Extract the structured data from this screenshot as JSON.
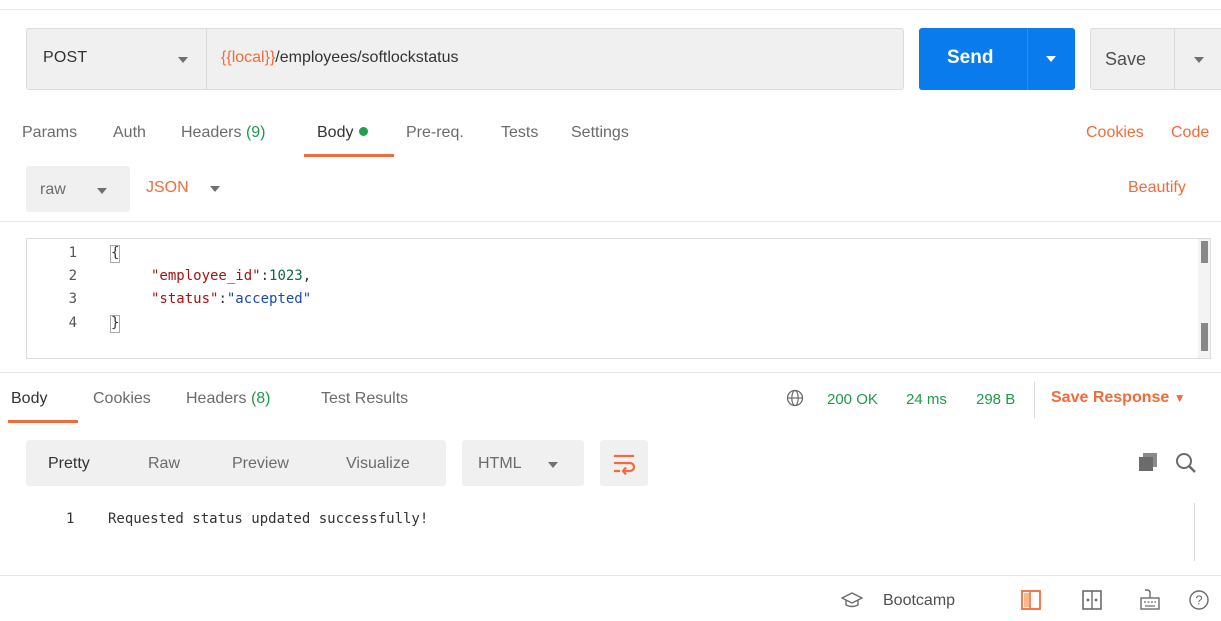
{
  "request": {
    "method": "POST",
    "url_variable": "{{local}}",
    "url_path": "/employees/softlockstatus",
    "send_label": "Send",
    "save_label": "Save"
  },
  "request_tabs": [
    {
      "label": "Params"
    },
    {
      "label": "Auth"
    },
    {
      "label": "Headers",
      "count": "(9)"
    },
    {
      "label": "Body",
      "active": true
    },
    {
      "label": "Pre-req."
    },
    {
      "label": "Tests"
    },
    {
      "label": "Settings"
    }
  ],
  "request_links": {
    "cookies": "Cookies",
    "code": "Code"
  },
  "body_mode": {
    "type": "raw",
    "language": "JSON",
    "beautify": "Beautify"
  },
  "editor": {
    "line_numbers": [
      "1",
      "2",
      "3",
      "4"
    ],
    "lines": {
      "l1": "{",
      "l2_key": "\"employee_id\"",
      "l2_colon": ":",
      "l2_value": "1023",
      "l2_comma": ",",
      "l3_key": "\"status\"",
      "l3_colon": ":",
      "l3_value": "\"accepted\"",
      "l4": "}"
    }
  },
  "response_tabs": [
    {
      "label": "Body",
      "active": true
    },
    {
      "label": "Cookies"
    },
    {
      "label": "Headers",
      "count": "(8)"
    },
    {
      "label": "Test Results"
    }
  ],
  "response_status": {
    "code": "200 OK",
    "time": "24 ms",
    "size": "298 B",
    "save_response": "Save Response"
  },
  "response_view": {
    "tabs": [
      "Pretty",
      "Raw",
      "Preview",
      "Visualize"
    ],
    "active": "Pretty",
    "format": "HTML",
    "line_number": "1",
    "content": "Requested status updated successfully!"
  },
  "footer": {
    "bootcamp": "Bootcamp"
  },
  "colors": {
    "accent": "#f26b3a",
    "send": "#097bed",
    "success": "#1e9b48"
  }
}
